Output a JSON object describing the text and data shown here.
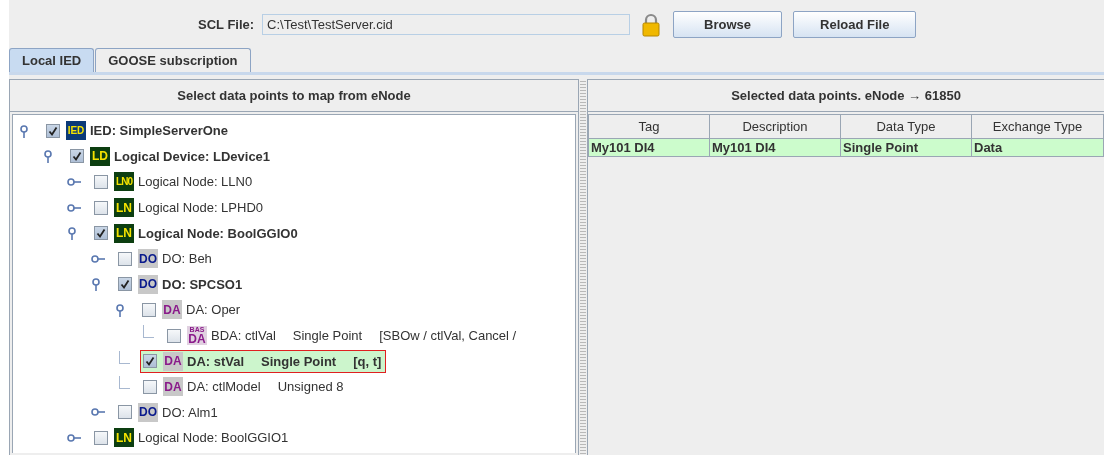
{
  "scl_file": {
    "label": "SCL File:",
    "value": "C:\\Test\\TestServer.cid"
  },
  "buttons": [
    {
      "label": "Browse"
    },
    {
      "label": "Reload File"
    }
  ],
  "tabs": [
    {
      "label": "Local IED",
      "selected": true
    },
    {
      "label": "GOOSE subscription",
      "selected": false
    }
  ],
  "left_panel": {
    "title": "Select data points to map from eNode",
    "tree": [
      {
        "kind": "ied",
        "badge": "IED",
        "label": "IED: SimpleServerOne",
        "checked": true,
        "expanded": true,
        "selected": false,
        "children": [
          {
            "kind": "ld",
            "badge": "LD",
            "label": "Logical Device: LDevice1",
            "checked": true,
            "expanded": true,
            "selected": false,
            "children": [
              {
                "kind": "ln0",
                "badge": "LN0",
                "label": "Logical Node: LLN0",
                "checked": false,
                "expanded": false,
                "selected": false
              },
              {
                "kind": "ln",
                "badge": "LN",
                "label": "Logical Node: LPHD0",
                "checked": false,
                "expanded": false,
                "selected": false
              },
              {
                "kind": "ln",
                "badge": "LN",
                "label": "Logical Node: BoolGGIO0",
                "checked": true,
                "expanded": true,
                "selected": false,
                "children": [
                  {
                    "kind": "do",
                    "badge": "DO",
                    "label": "DO: Beh",
                    "checked": false,
                    "expanded": false,
                    "selected": false
                  },
                  {
                    "kind": "do",
                    "badge": "DO",
                    "label": "DO: SPCSO1",
                    "checked": true,
                    "expanded": true,
                    "selected": false,
                    "children": [
                      {
                        "kind": "da",
                        "badge": "DA",
                        "label": "DA: Oper",
                        "checked": false,
                        "expanded": true,
                        "selected": false,
                        "children": [
                          {
                            "kind": "bda",
                            "badge_top": "BAS",
                            "badge": "DA",
                            "label": "BDA: ctlVal",
                            "type": "Single Point",
                            "options": "[SBOw / ctlVal, Cancel /",
                            "checked": false,
                            "selected": false
                          }
                        ]
                      },
                      {
                        "kind": "da",
                        "badge": "DA",
                        "label": "DA: stVal",
                        "type": "Single Point",
                        "options": "[q, t]",
                        "checked": true,
                        "selected": true
                      },
                      {
                        "kind": "da",
                        "badge": "DA",
                        "label": "DA: ctlModel",
                        "type": "Unsigned 8",
                        "checked": false,
                        "selected": false
                      }
                    ]
                  },
                  {
                    "kind": "do",
                    "badge": "DO",
                    "label": "DO: Alm1",
                    "checked": false,
                    "expanded": false,
                    "selected": false
                  }
                ]
              },
              {
                "kind": "ln",
                "badge": "LN",
                "label": "Logical Node: BoolGGIO1",
                "checked": false,
                "expanded": false,
                "selected": false
              }
            ]
          }
        ]
      }
    ]
  },
  "right_panel": {
    "title": "Selected data points. eNode → 61850",
    "table": {
      "columns": [
        "Tag",
        "Description",
        "Data Type",
        "Exchange Type"
      ],
      "rows": [
        {
          "cells": [
            "My101 DI4",
            "My101 DI4",
            "Single Point",
            "Data"
          ],
          "selected": true
        }
      ]
    }
  }
}
